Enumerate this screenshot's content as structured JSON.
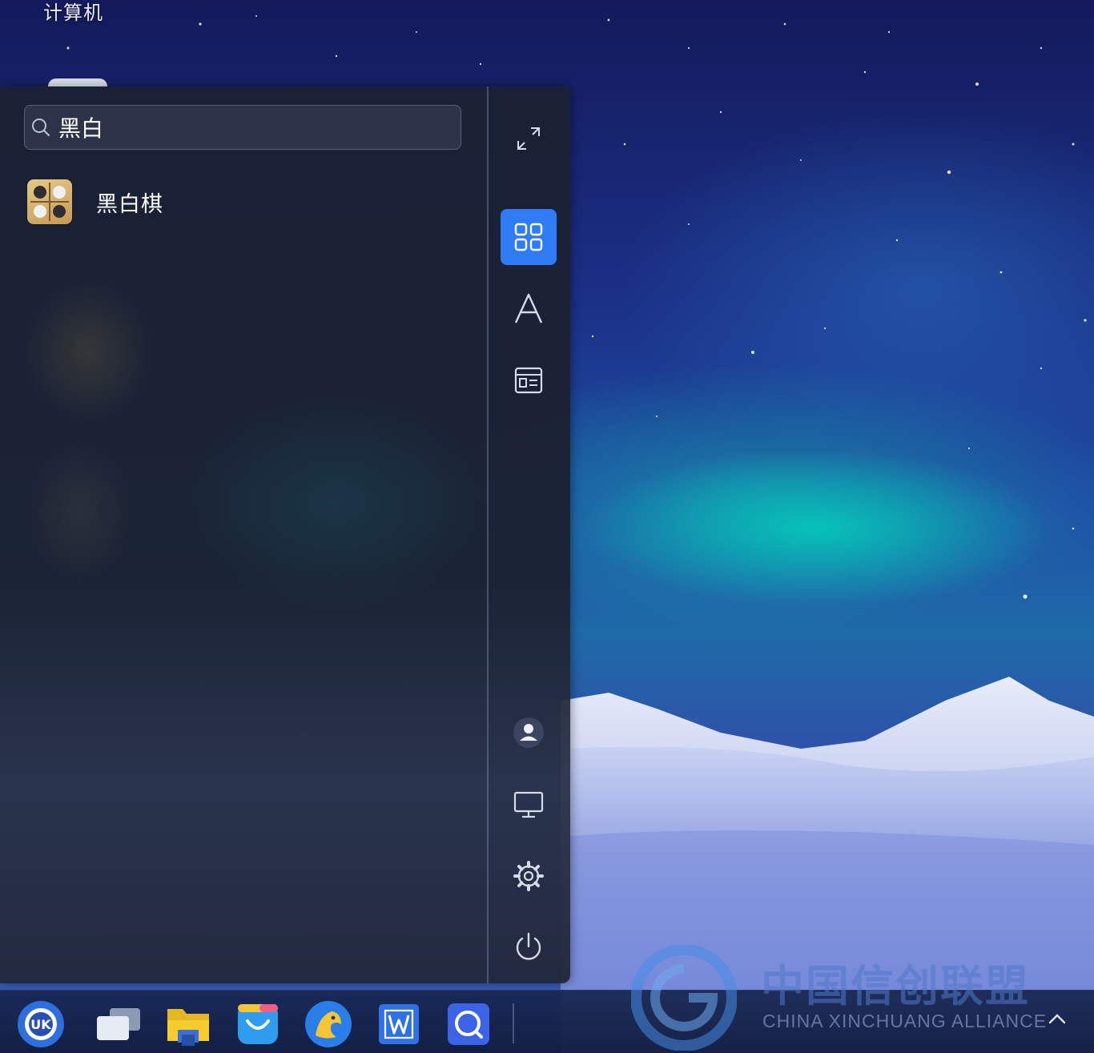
{
  "desktop": {
    "icon_label": "计算机"
  },
  "start_menu": {
    "search": {
      "value": "黑白",
      "placeholder": ""
    },
    "results": [
      {
        "label": "黑白棋",
        "icon": "reversi-game-icon"
      }
    ],
    "sidebar_top": [
      {
        "name": "fullscreen-toggle",
        "icon": "expand-icon",
        "active": false
      },
      {
        "name": "all-apps-view",
        "icon": "grid-icon",
        "active": true
      },
      {
        "name": "alphabetical-view",
        "icon": "letter-a-icon",
        "active": false
      },
      {
        "name": "category-view",
        "icon": "category-list-icon",
        "active": false
      }
    ],
    "sidebar_bottom": [
      {
        "name": "user-account",
        "icon": "user-icon"
      },
      {
        "name": "computer",
        "icon": "monitor-icon"
      },
      {
        "name": "settings",
        "icon": "gear-icon"
      },
      {
        "name": "power",
        "icon": "power-icon"
      }
    ],
    "accent_color": "#2f7cf6"
  },
  "taskbar": {
    "items": [
      {
        "name": "start-menu",
        "icon": "uk-logo-icon"
      },
      {
        "name": "multitasking-view",
        "icon": "windows-stack-icon"
      },
      {
        "name": "file-manager",
        "icon": "folder-icon"
      },
      {
        "name": "software-store",
        "icon": "shopping-bag-icon"
      },
      {
        "name": "web-browser",
        "icon": "browser-icon"
      },
      {
        "name": "wps-writer",
        "icon": "wps-w-icon"
      },
      {
        "name": "search-tool",
        "icon": "magnifier-app-icon"
      }
    ]
  },
  "watermark": {
    "cn": "中国信创联盟",
    "en": "CHINA XINCHUANG ALLIANCE"
  }
}
